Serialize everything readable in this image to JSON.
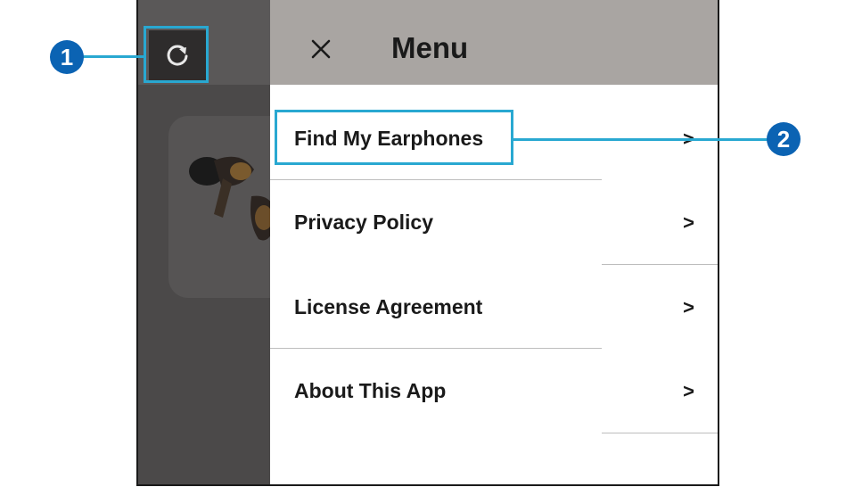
{
  "menu": {
    "title": "Menu",
    "items": [
      {
        "label": "Find My Earphones",
        "chevron": ">"
      },
      {
        "label": "Privacy Policy",
        "chevron": ">"
      },
      {
        "label": "License Agreement",
        "chevron": ">"
      },
      {
        "label": "About This App",
        "chevron": ">"
      }
    ]
  },
  "callouts": {
    "refresh": "1",
    "find_my_earphones": "2"
  },
  "icons": {
    "refresh": "refresh-icon",
    "close": "close-icon",
    "device": "earphones-icon"
  },
  "colors": {
    "highlight": "#29a8d1",
    "callout": "#0b63b3",
    "menu_header": "#a9a5a2",
    "overlay": "#4b4949"
  }
}
